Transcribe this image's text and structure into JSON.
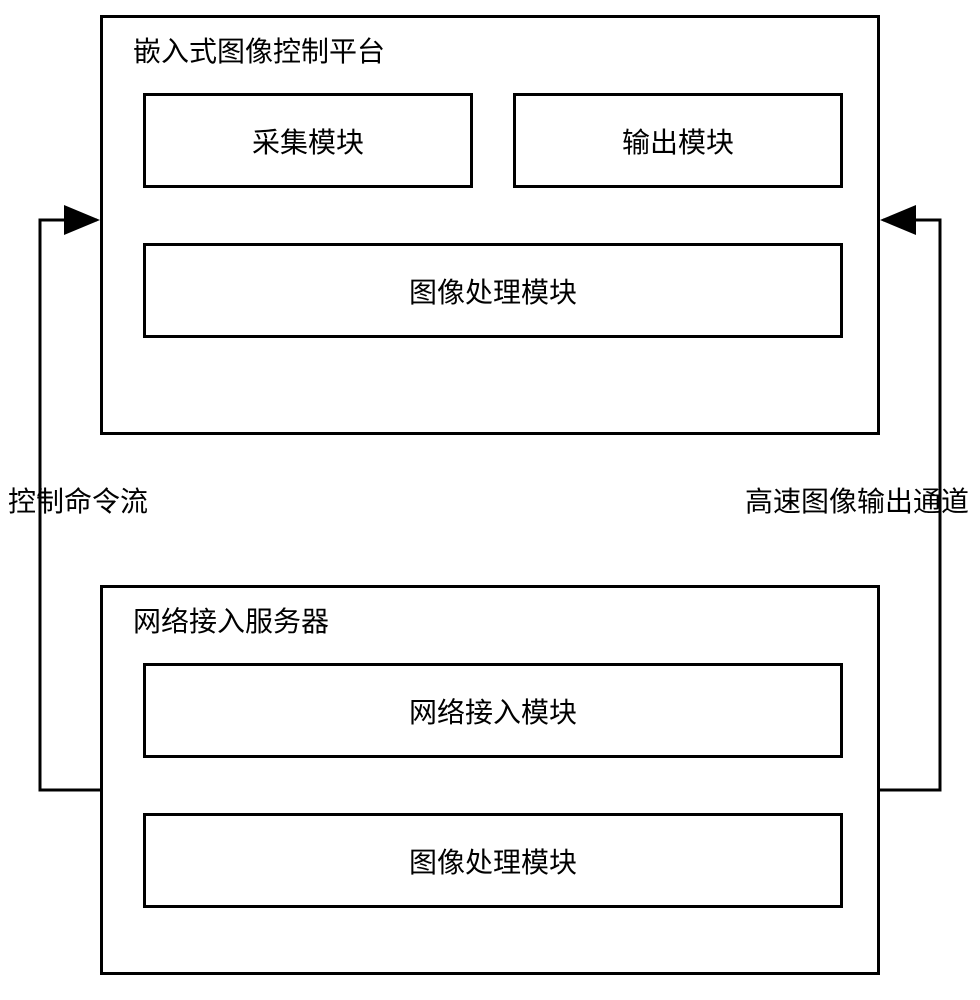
{
  "top_box": {
    "title": "嵌入式图像控制平台",
    "acquisition": "采集模块",
    "output": "输出模块",
    "image_processing": "图像处理模块"
  },
  "bottom_box": {
    "title": "网络接入服务器",
    "network_access": "网络接入模块",
    "image_processing": "图像处理模块"
  },
  "flows": {
    "left": "控制命令流",
    "right": "高速图像输出通道"
  }
}
